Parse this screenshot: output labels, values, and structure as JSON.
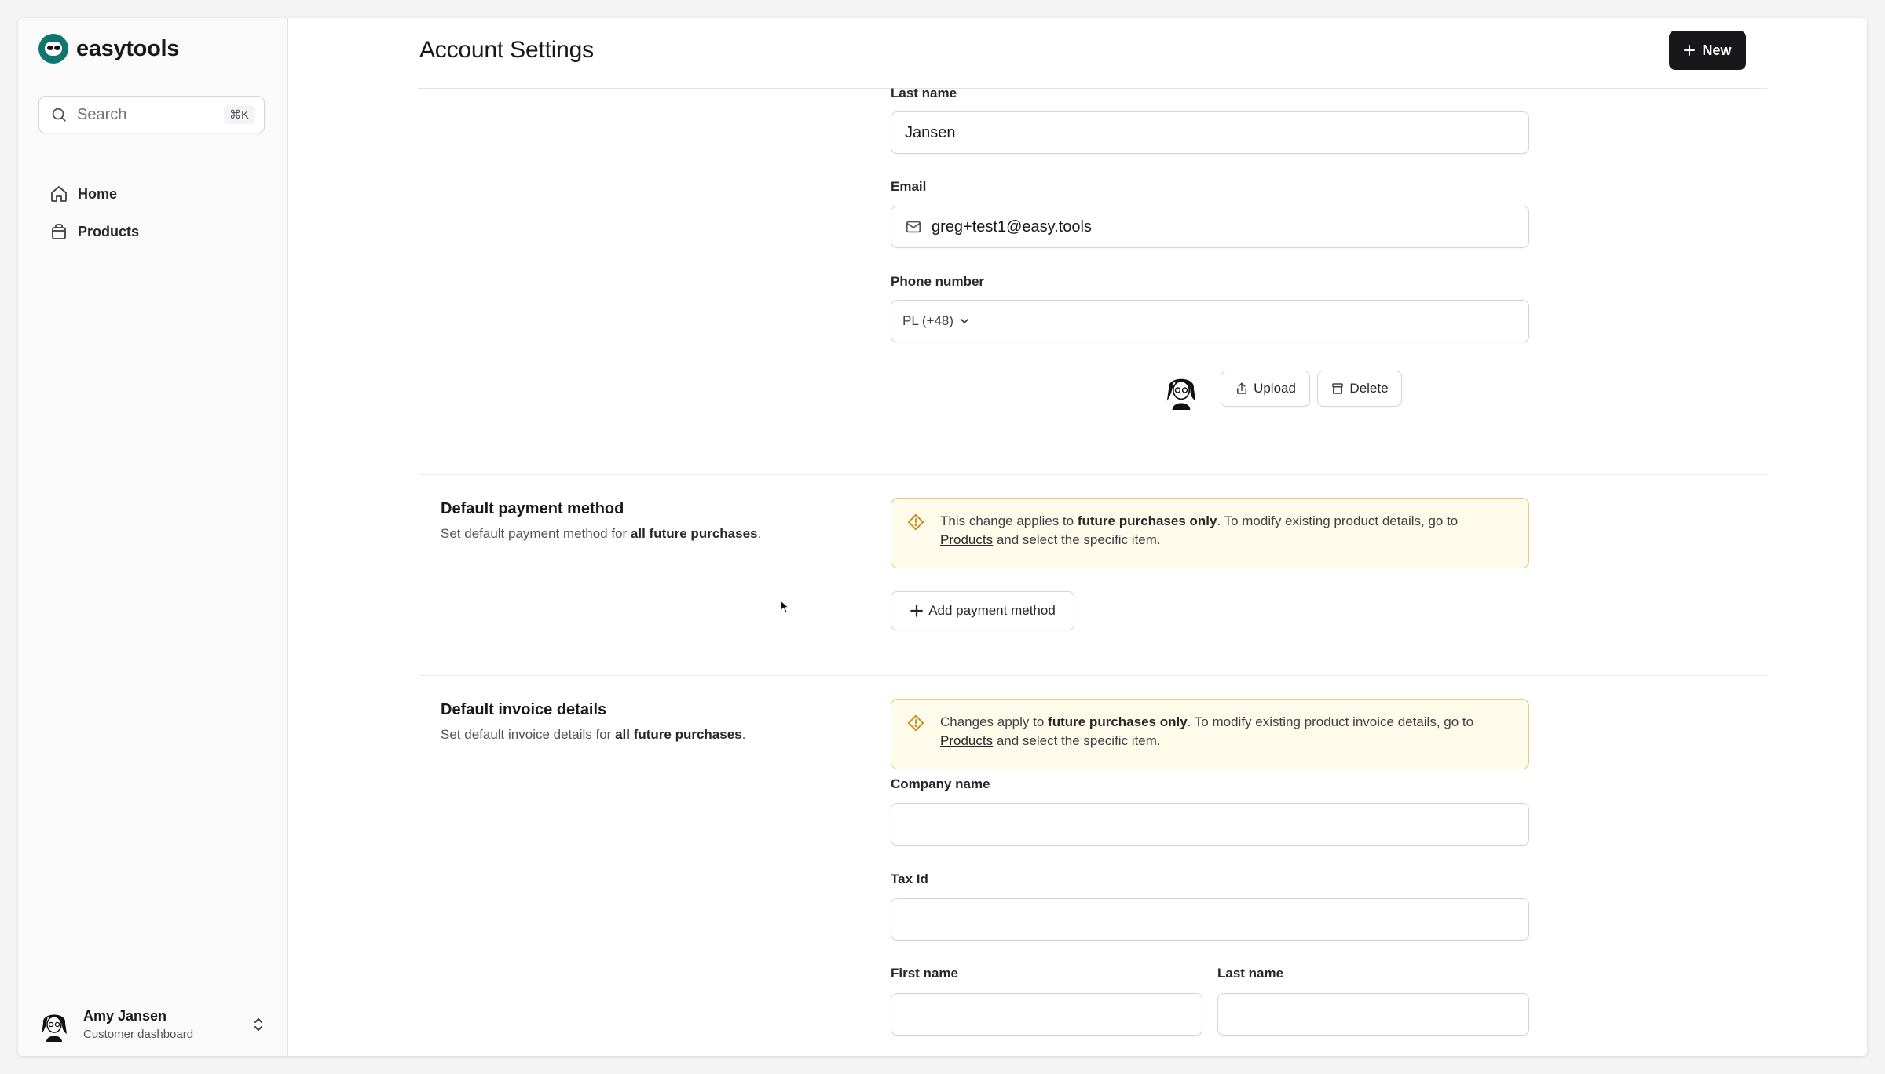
{
  "brand": {
    "name": "easytools",
    "accent": "#0f766e"
  },
  "search": {
    "placeholder": "Search",
    "shortcut": "⌘K"
  },
  "nav": {
    "items": [
      {
        "label": "Home",
        "icon": "home-icon"
      },
      {
        "label": "Products",
        "icon": "bag-icon"
      }
    ]
  },
  "user": {
    "name": "Amy Jansen",
    "role": "Customer dashboard"
  },
  "header": {
    "title": "Account Settings",
    "new_label": "New"
  },
  "profile": {
    "last_name_label": "Last name",
    "last_name_value": "Jansen",
    "email_label": "Email",
    "email_value": "greg+test1@easy.tools",
    "phone_label": "Phone number",
    "phone_country": "PL (+48)",
    "upload_label": "Upload",
    "delete_label": "Delete"
  },
  "payment": {
    "title": "Default payment method",
    "desc_prefix": "Set default payment method for ",
    "desc_bold": "all future purchases",
    "desc_suffix": ".",
    "alert_part1": "This change applies to ",
    "alert_bold": "future purchases only",
    "alert_part2": ". To modify existing product details, go to",
    "alert_link": "Products",
    "alert_part3": " and select the specific item.",
    "add_label": "Add payment method"
  },
  "invoice": {
    "title": "Default invoice details",
    "desc_prefix": "Set default invoice details for ",
    "desc_bold": "all future purchases",
    "desc_suffix": ".",
    "alert_part1": "Changes apply to ",
    "alert_bold": "future purchases only",
    "alert_part2": ". To modify existing product invoice details, go to",
    "alert_link": "Products",
    "alert_part3": " and select the specific item.",
    "company_label": "Company name",
    "company_value": "",
    "tax_label": "Tax Id",
    "tax_value": "",
    "first_name_label": "First name",
    "first_name_value": "",
    "last_name_label": "Last name",
    "last_name_value": ""
  }
}
